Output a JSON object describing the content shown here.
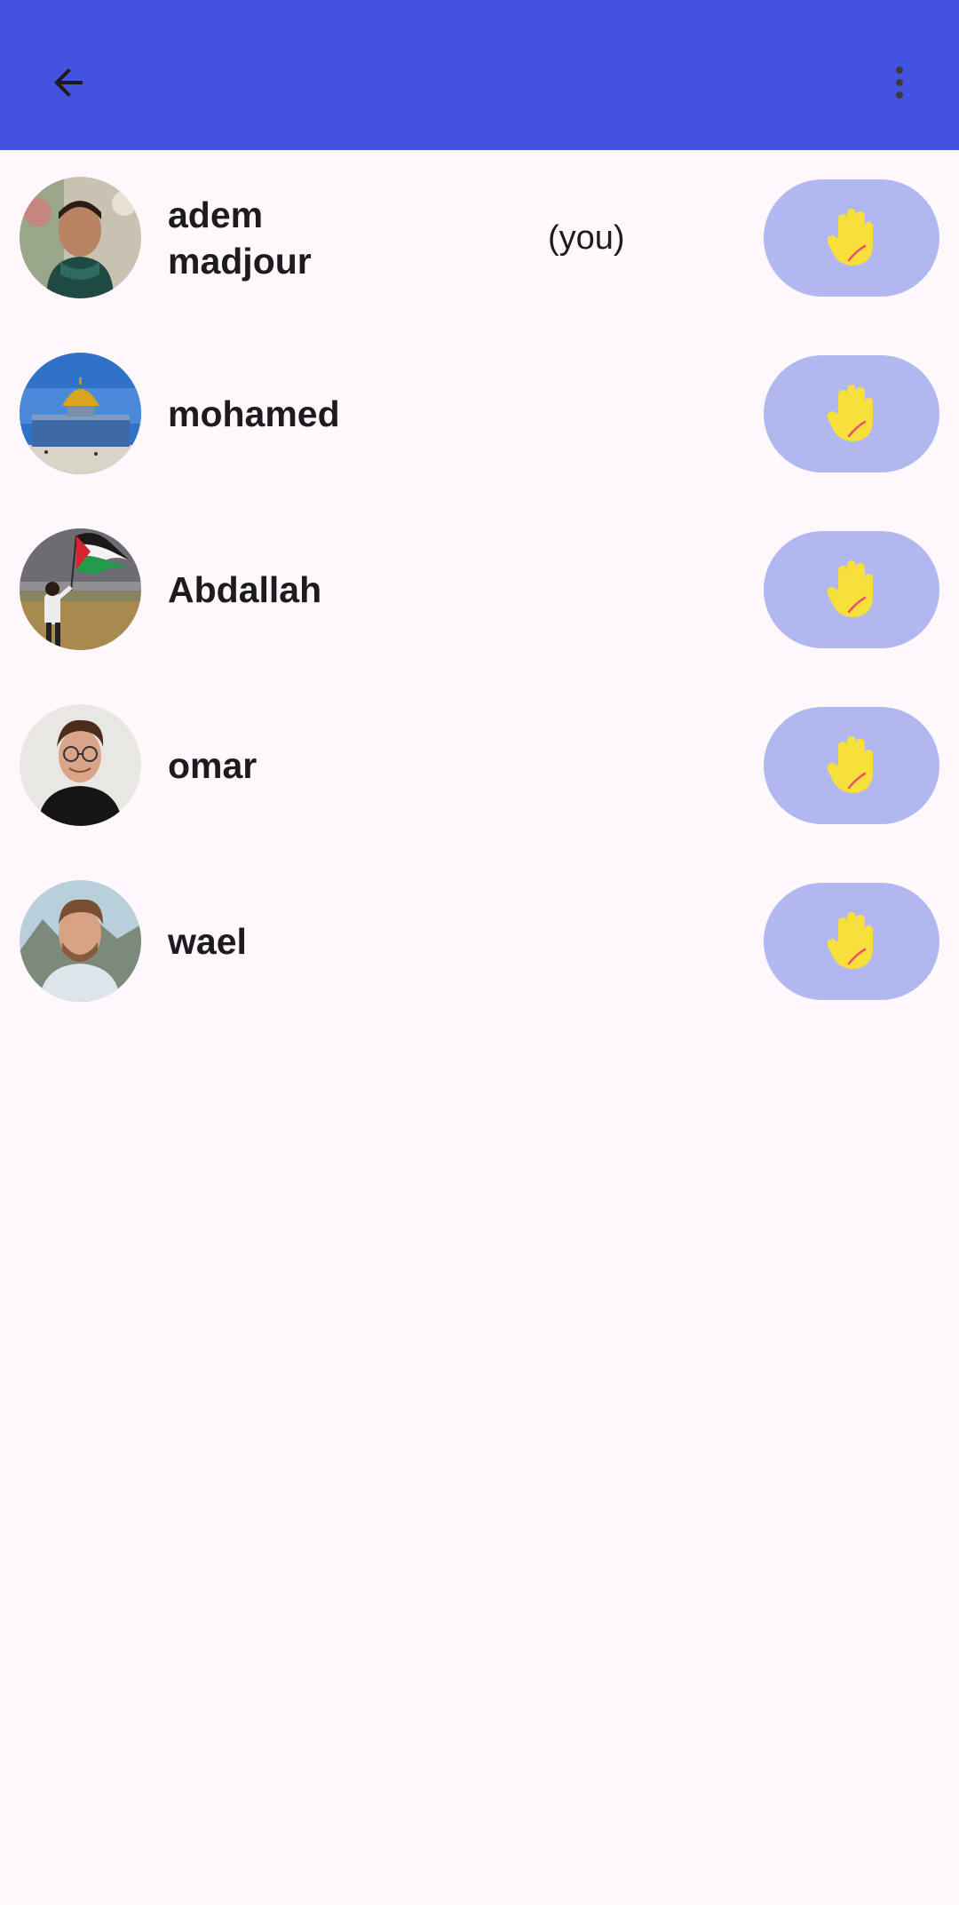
{
  "appbar": {
    "back_icon": "arrow-back-icon",
    "menu_icon": "more-vert-icon",
    "background": "#4353de"
  },
  "participants": [
    {
      "name": "adem madjour",
      "tag": "(you)",
      "avatar": "portrait-man-scarf"
    },
    {
      "name": "mohamed",
      "tag": "",
      "avatar": "dome-of-the-rock"
    },
    {
      "name": "Abdallah",
      "tag": "",
      "avatar": "man-waving-flag"
    },
    {
      "name": "omar",
      "tag": "",
      "avatar": "portrait-man-glasses"
    },
    {
      "name": "wael",
      "tag": "",
      "avatar": "portrait-man-mountains"
    }
  ],
  "wave_button": {
    "icon": "raised-hand-icon",
    "background": "#b1b7ef",
    "hand_color": "#f7df3c"
  }
}
